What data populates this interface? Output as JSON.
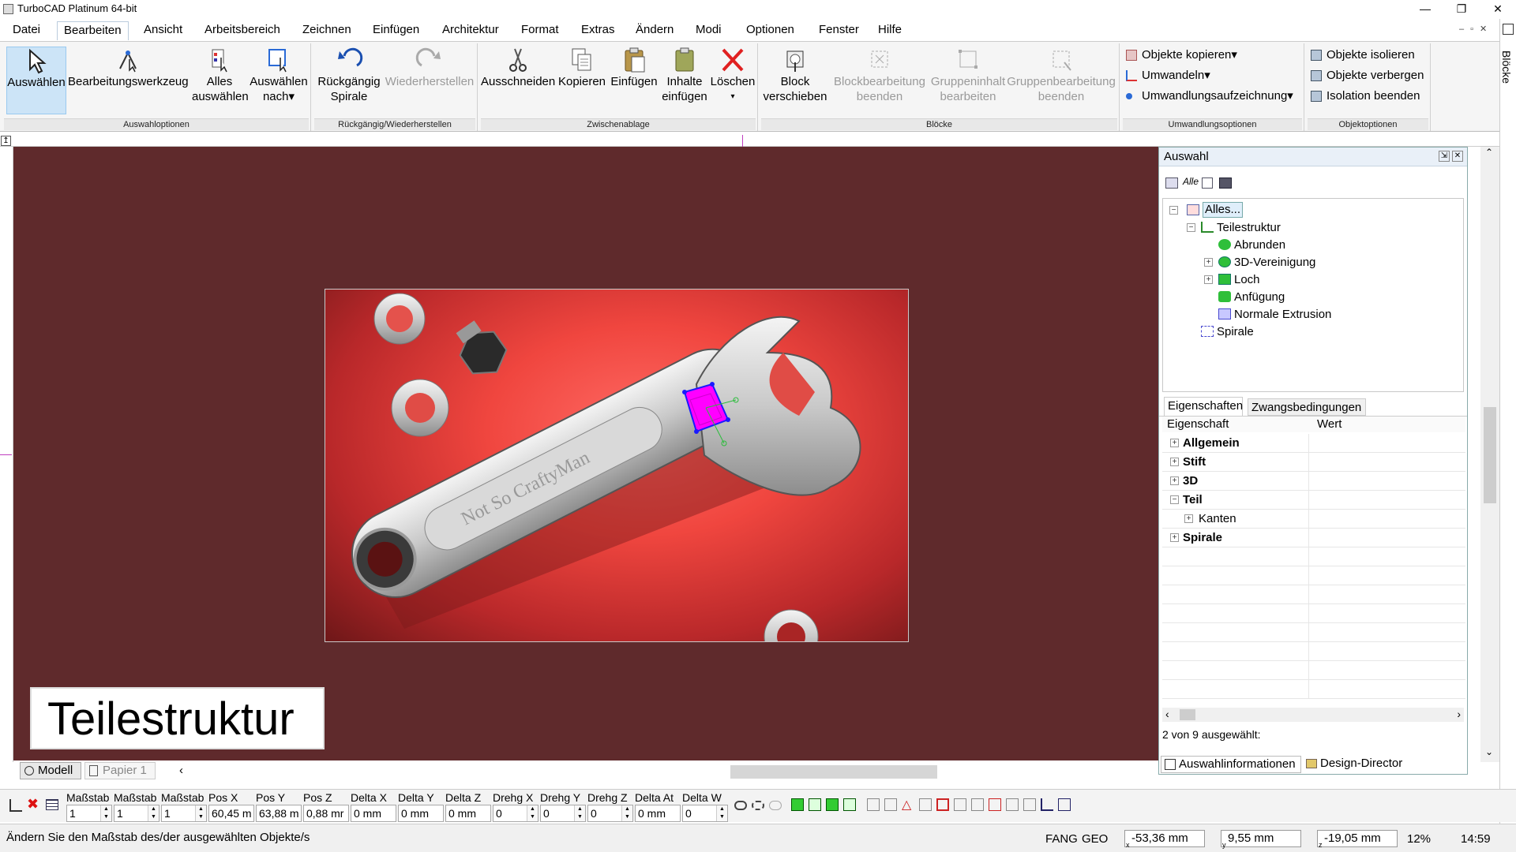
{
  "titlebar": {
    "title": "TurboCAD  Platinum 64-bit",
    "min": "—",
    "max": "❐",
    "close": "✕"
  },
  "menu": [
    "Datei",
    "Bearbeiten",
    "Ansicht",
    "Arbeitsbereich",
    "Zeichnen",
    "Einfügen",
    "Architektur",
    "Format",
    "Extras",
    "Ändern",
    "Modi",
    "Optionen",
    "Fenster",
    "Hilfe"
  ],
  "ribbon": {
    "groups": {
      "auswahl": "Auswahloptionen",
      "undo": "Rückgängig/Wiederherstellen",
      "clip": "Zwischenablage",
      "bloecke": "Blöcke",
      "umw": "Umwandlungsoptionen",
      "obj": "Objektoptionen"
    },
    "buttons": {
      "auswaehlen": "Auswählen",
      "bearbeitungswerkzeug": "Bearbeitungswerkzeug",
      "alles1": "Alles",
      "alles2": "auswählen",
      "auswnach1": "Auswählen",
      "auswnach2": "nach▾",
      "rueck1": "Rückgängig",
      "rueck2": "Spirale",
      "wieder": "Wiederherstellen",
      "ausschneiden": "Ausschneiden",
      "kopieren": "Kopieren",
      "einfuegen": "Einfügen",
      "inhalte1": "Inhalte",
      "inhalte2": "einfügen",
      "loeschen1": "Löschen",
      "loeschen2": "▾",
      "block1": "Block",
      "block2": "verschieben",
      "bb1": "Blockbearbeitung",
      "bb2": "beenden",
      "gi1": "Gruppeninhalt",
      "gi2": "bearbeiten",
      "gb1": "Gruppenbearbeitung",
      "gb2": "beenden",
      "objkop": "Objekte kopieren▾",
      "umwandeln": "Umwandeln▾",
      "umwaufz": "Umwandlungsaufzeichnung▾",
      "isolieren": "Objekte isolieren",
      "verbergen": "Objekte verbergen",
      "isoend": "Isolation beenden"
    }
  },
  "canvas": {
    "overlay_label": "Teilestruktur",
    "engraving": "Not So CraftyMan"
  },
  "panel": {
    "title": "Auswahl",
    "toolbar_alle": "Alle",
    "tree": [
      {
        "label": "Alles...",
        "indent": 0,
        "exp": "⊟"
      },
      {
        "label": "Teilestruktur",
        "indent": 1,
        "exp": "⊟"
      },
      {
        "label": "Abrunden",
        "indent": 2,
        "exp": ""
      },
      {
        "label": "3D-Vereinigung",
        "indent": 2,
        "exp": "+"
      },
      {
        "label": "Loch",
        "indent": 2,
        "exp": "+"
      },
      {
        "label": "Anfügung",
        "indent": 2,
        "exp": ""
      },
      {
        "label": "Normale Extrusion",
        "indent": 2,
        "exp": ""
      },
      {
        "label": "Spirale",
        "indent": 1,
        "exp": ""
      }
    ],
    "tabs": [
      "Eigenschaften",
      "Zwangsbedingungen"
    ],
    "col_prop": "Eigenschaft",
    "col_val": "Wert",
    "props": [
      {
        "name": "Allgemein",
        "exp": "+",
        "sub": false
      },
      {
        "name": "Stift",
        "exp": "+",
        "sub": false
      },
      {
        "name": "3D",
        "exp": "+",
        "sub": false
      },
      {
        "name": "Teil",
        "exp": "−",
        "sub": false
      },
      {
        "name": "Kanten",
        "exp": "+",
        "sub": true
      },
      {
        "name": "Spirale",
        "exp": "+",
        "sub": false
      }
    ],
    "selection_count": "2 von 9 ausgewählt:",
    "bottom_tabs": [
      "Auswahlinformationen",
      "Design-Director"
    ]
  },
  "right_strip": "Blöcke",
  "layout_tabs": [
    "Modell",
    "Papier 1"
  ],
  "coords": [
    {
      "label": "Maßstab",
      "value": "1"
    },
    {
      "label": "Maßstab",
      "value": "1"
    },
    {
      "label": "Maßstab",
      "value": "1"
    },
    {
      "label": "Pos X",
      "value": "60,45 m"
    },
    {
      "label": "Pos Y",
      "value": "63,88 m"
    },
    {
      "label": "Pos Z",
      "value": "0,88 mr"
    },
    {
      "label": "Delta X",
      "value": "0 mm"
    },
    {
      "label": "Delta Y",
      "value": "0 mm"
    },
    {
      "label": "Delta Z",
      "value": "0 mm"
    },
    {
      "label": "Drehg X",
      "value": "0"
    },
    {
      "label": "Drehg Y",
      "value": "0"
    },
    {
      "label": "Drehg Z",
      "value": "0"
    },
    {
      "label": "Delta At",
      "value": "0 mm"
    },
    {
      "label": "Delta W",
      "value": "0"
    }
  ],
  "status": {
    "message": "Ändern Sie den Maßstab des/der ausgewählten Objekte/s",
    "fang": "FANG",
    "geo": "GEO",
    "x": "-53,36 mm",
    "y": "9,55 mm",
    "z": "-19,05 mm",
    "zoom": "12%",
    "time": "14:59"
  },
  "colors": {
    "canvas": "#5f2a2c",
    "image_red": "#f0463f",
    "selection": "#ff00ff",
    "accent": "#cce4f7"
  }
}
